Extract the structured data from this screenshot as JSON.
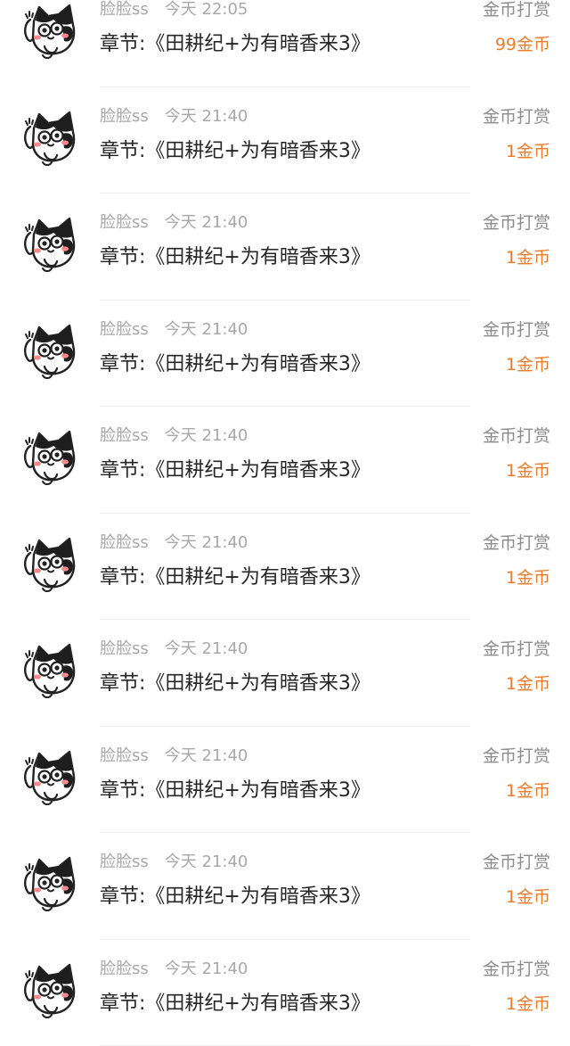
{
  "colors": {
    "amount": "#f07c2a",
    "meta": "#a8a8a8",
    "chapter": "#262626",
    "type": "#8c8c8c"
  },
  "records": [
    {
      "user": "脸脸ss",
      "time": "今天 22:05",
      "chapter": "章节:《田耕纪+为有暗香来3》",
      "type": "金币打赏",
      "amount": "99金币",
      "avatar_icon": "cat-avatar-icon"
    },
    {
      "user": "脸脸ss",
      "time": "今天 21:40",
      "chapter": "章节:《田耕纪+为有暗香来3》",
      "type": "金币打赏",
      "amount": "1金币",
      "avatar_icon": "cat-avatar-icon"
    },
    {
      "user": "脸脸ss",
      "time": "今天 21:40",
      "chapter": "章节:《田耕纪+为有暗香来3》",
      "type": "金币打赏",
      "amount": "1金币",
      "avatar_icon": "cat-avatar-icon"
    },
    {
      "user": "脸脸ss",
      "time": "今天 21:40",
      "chapter": "章节:《田耕纪+为有暗香来3》",
      "type": "金币打赏",
      "amount": "1金币",
      "avatar_icon": "cat-avatar-icon"
    },
    {
      "user": "脸脸ss",
      "time": "今天 21:40",
      "chapter": "章节:《田耕纪+为有暗香来3》",
      "type": "金币打赏",
      "amount": "1金币",
      "avatar_icon": "cat-avatar-icon"
    },
    {
      "user": "脸脸ss",
      "time": "今天 21:40",
      "chapter": "章节:《田耕纪+为有暗香来3》",
      "type": "金币打赏",
      "amount": "1金币",
      "avatar_icon": "cat-avatar-icon"
    },
    {
      "user": "脸脸ss",
      "time": "今天 21:40",
      "chapter": "章节:《田耕纪+为有暗香来3》",
      "type": "金币打赏",
      "amount": "1金币",
      "avatar_icon": "cat-avatar-icon"
    },
    {
      "user": "脸脸ss",
      "time": "今天 21:40",
      "chapter": "章节:《田耕纪+为有暗香来3》",
      "type": "金币打赏",
      "amount": "1金币",
      "avatar_icon": "cat-avatar-icon"
    },
    {
      "user": "脸脸ss",
      "time": "今天 21:40",
      "chapter": "章节:《田耕纪+为有暗香来3》",
      "type": "金币打赏",
      "amount": "1金币",
      "avatar_icon": "cat-avatar-icon"
    },
    {
      "user": "脸脸ss",
      "time": "今天 21:40",
      "chapter": "章节:《田耕纪+为有暗香来3》",
      "type": "金币打赏",
      "amount": "1金币",
      "avatar_icon": "cat-avatar-icon"
    }
  ]
}
